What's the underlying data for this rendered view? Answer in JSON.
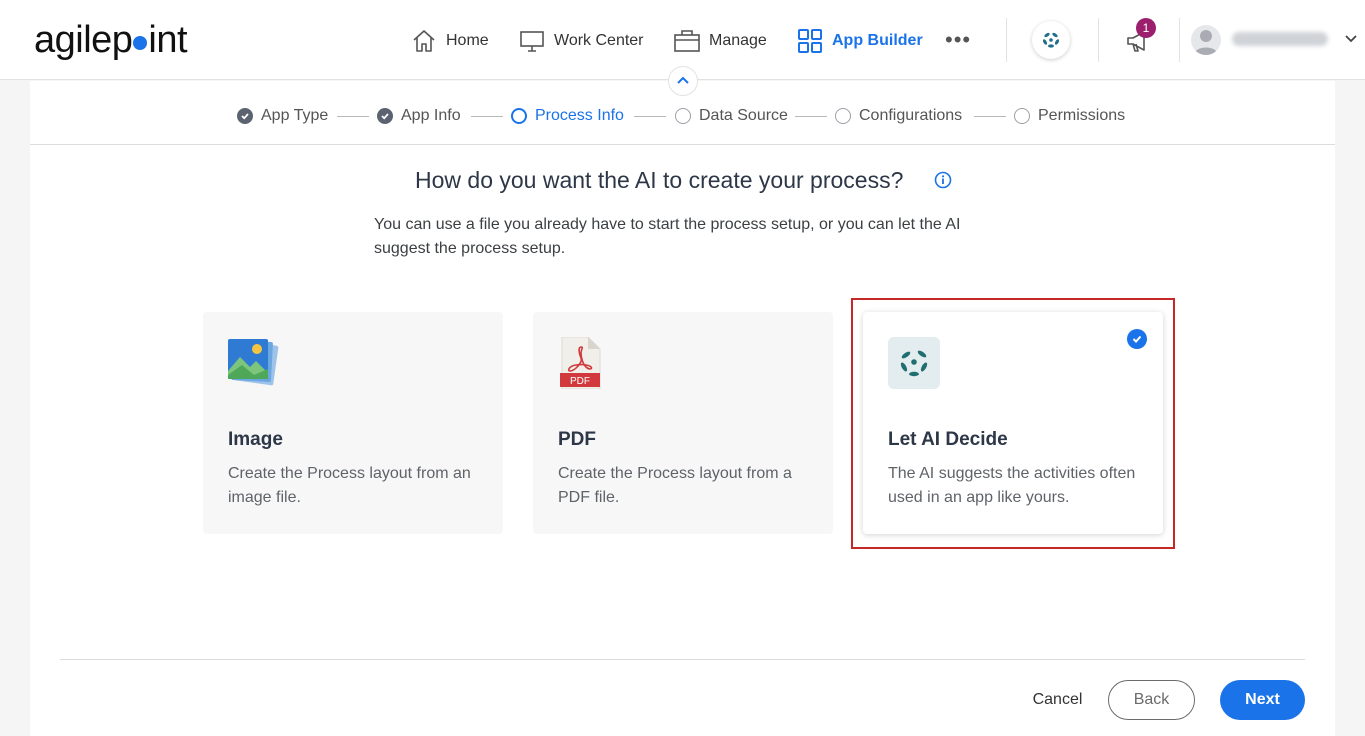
{
  "app": {
    "logo_pre": "agilep",
    "logo_post": "int"
  },
  "nav": {
    "home": "Home",
    "work_center": "Work Center",
    "manage": "Manage",
    "app_builder": "App Builder",
    "more": "•••",
    "notifications_count": "1",
    "user_name": "",
    "accent_color": "#1a73e8"
  },
  "stepper": {
    "steps": [
      {
        "label": "App Type",
        "state": "done"
      },
      {
        "label": "App Info",
        "state": "done"
      },
      {
        "label": "Process Info",
        "state": "current"
      },
      {
        "label": "Data Source",
        "state": "todo"
      },
      {
        "label": "Configurations",
        "state": "todo"
      },
      {
        "label": "Permissions",
        "state": "todo"
      }
    ]
  },
  "main": {
    "heading": "How do you want the AI to create your process?",
    "description": "You can use a file you already have to start the process setup, or you can let the AI suggest the process setup.",
    "options": [
      {
        "title": "Image",
        "description": "Create the Process layout from an image file.",
        "icon": "image-icon",
        "selected": false
      },
      {
        "title": "PDF",
        "description": "Create the Process layout from a PDF file.",
        "icon": "pdf-icon",
        "selected": false
      },
      {
        "title": "Let AI Decide",
        "description": "The AI suggests the activities often used in an app like yours.",
        "icon": "ai-icon",
        "selected": true
      }
    ],
    "pdf_label": "PDF"
  },
  "footer": {
    "cancel": "Cancel",
    "back": "Back",
    "next": "Next"
  }
}
